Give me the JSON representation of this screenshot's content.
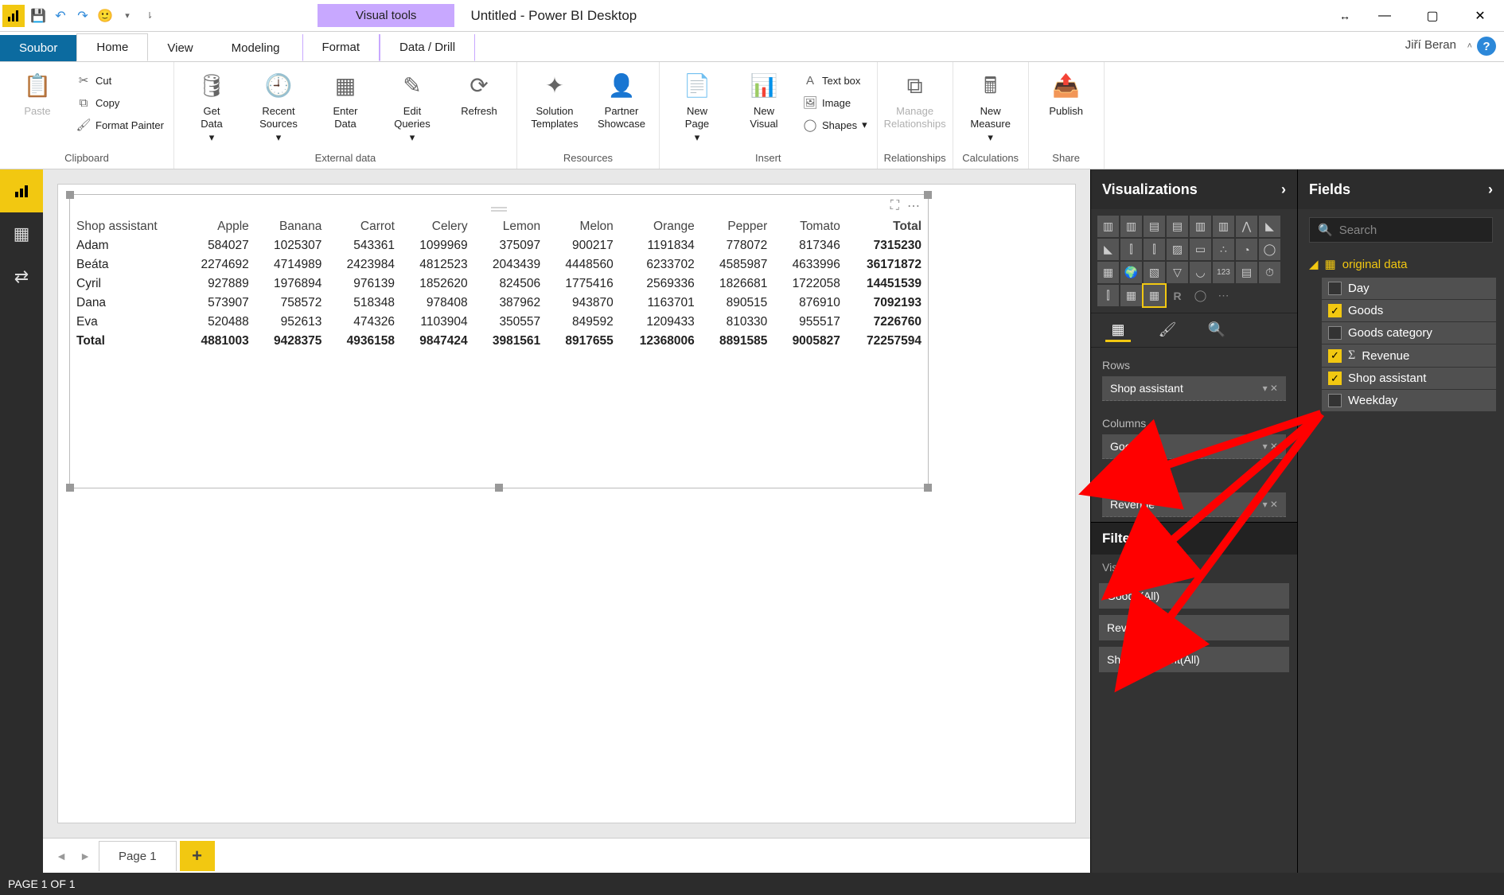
{
  "titlebar": {
    "visual_tools": "Visual tools",
    "title": "Untitled - Power BI Desktop"
  },
  "tabs": {
    "file": "Soubor",
    "home": "Home",
    "view": "View",
    "modeling": "Modeling",
    "format": "Format",
    "datadrill": "Data / Drill"
  },
  "user": "Jiří Beran",
  "ribbon": {
    "clipboard": {
      "label": "Clipboard",
      "paste": "Paste",
      "cut": "Cut",
      "copy": "Copy",
      "painter": "Format Painter"
    },
    "external": {
      "label": "External data",
      "getdata": "Get\nData",
      "recent": "Recent\nSources",
      "enter": "Enter\nData",
      "edit": "Edit\nQueries",
      "refresh": "Refresh"
    },
    "resources": {
      "label": "Resources",
      "solution": "Solution\nTemplates",
      "partner": "Partner\nShowcase"
    },
    "insert": {
      "label": "Insert",
      "newpage": "New\nPage",
      "newvisual": "New\nVisual",
      "textbox": "Text box",
      "image": "Image",
      "shapes": "Shapes"
    },
    "relationships": {
      "label": "Relationships",
      "manage": "Manage\nRelationships"
    },
    "calculations": {
      "label": "Calculations",
      "measure": "New\nMeasure"
    },
    "share": {
      "label": "Share",
      "publish": "Publish"
    }
  },
  "chart_data": {
    "type": "table",
    "row_header": "Shop assistant",
    "columns": [
      "Apple",
      "Banana",
      "Carrot",
      "Celery",
      "Lemon",
      "Melon",
      "Orange",
      "Pepper",
      "Tomato",
      "Total"
    ],
    "rows": [
      {
        "name": "Adam",
        "values": [
          584027,
          1025307,
          543361,
          1099969,
          375097,
          900217,
          1191834,
          778072,
          817346,
          7315230
        ]
      },
      {
        "name": "Beáta",
        "values": [
          2274692,
          4714989,
          2423984,
          4812523,
          2043439,
          4448560,
          6233702,
          4585987,
          4633996,
          36171872
        ]
      },
      {
        "name": "Cyril",
        "values": [
          927889,
          1976894,
          976139,
          1852620,
          824506,
          1775416,
          2569336,
          1826681,
          1722058,
          14451539
        ]
      },
      {
        "name": "Dana",
        "values": [
          573907,
          758572,
          518348,
          978408,
          387962,
          943870,
          1163701,
          890515,
          876910,
          7092193
        ]
      },
      {
        "name": "Eva",
        "values": [
          520488,
          952613,
          474326,
          1103904,
          350557,
          849592,
          1209433,
          810330,
          955517,
          7226760
        ]
      }
    ],
    "totals": {
      "name": "Total",
      "values": [
        4881003,
        9428375,
        4936158,
        9847424,
        3981561,
        8917655,
        12368006,
        8891585,
        9005827,
        72257594
      ]
    }
  },
  "pagetabs": {
    "page1": "Page 1"
  },
  "statusbar": "PAGE 1 OF 1",
  "viz_pane": {
    "header": "Visualizations",
    "rows_label": "Rows",
    "rows_item": "Shop assistant",
    "columns_label": "Columns",
    "columns_item": "Goods",
    "values_label": "Values",
    "values_item": "Revenue",
    "filters_header": "Filters",
    "filters_sub": "Visual level filters",
    "filter1": "Goods(All)",
    "filter2": "Revenue(All)",
    "filter3": "Shop assistant(All)"
  },
  "fields_pane": {
    "header": "Fields",
    "search_placeholder": "Search",
    "table": "original data",
    "fields": [
      {
        "name": "Day",
        "checked": false,
        "sigma": false
      },
      {
        "name": "Goods",
        "checked": true,
        "sigma": false
      },
      {
        "name": "Goods category",
        "checked": false,
        "sigma": false
      },
      {
        "name": "Revenue",
        "checked": true,
        "sigma": true
      },
      {
        "name": "Shop assistant",
        "checked": true,
        "sigma": false
      },
      {
        "name": "Weekday",
        "checked": false,
        "sigma": false
      }
    ]
  }
}
